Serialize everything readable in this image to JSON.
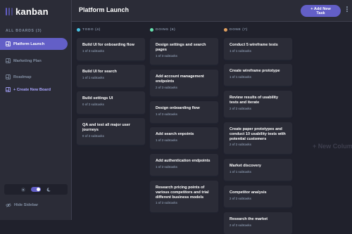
{
  "logo": {
    "text": "kanban"
  },
  "sidebar": {
    "boards_title": "ALL BOARDS (3)",
    "items": [
      {
        "label": "Platform Launch",
        "active": true
      },
      {
        "label": "Marketing Plan",
        "active": false
      },
      {
        "label": "Roadmap",
        "active": false
      }
    ],
    "create_label": "+ Create New Board",
    "hide_label": "Hide Sidebar"
  },
  "header": {
    "board_title": "Platform Launch",
    "add_task_line1": "+ Add New",
    "add_task_line2": "Task"
  },
  "columns": [
    {
      "title": "TODO (4)",
      "color": "#49c4e5",
      "tasks": [
        {
          "title": "Build UI for onboarding flow",
          "subtasks": "1 of 3 subtasks"
        },
        {
          "title": "Build UI for search",
          "subtasks": "1 of 1 subtasks"
        },
        {
          "title": "Build settings UI",
          "subtasks": "0 of 2 subtasks"
        },
        {
          "title": "QA and test all major user journeys",
          "subtasks": "0 of 2 subtasks"
        }
      ]
    },
    {
      "title": "DOING (6)",
      "color": "#67e2ae",
      "tasks": [
        {
          "title": "Design settings and search pages",
          "subtasks": "1 of 3 subtasks"
        },
        {
          "title": "Add account management endpoints",
          "subtasks": "2 of 3 subtasks"
        },
        {
          "title": "Design onboarding flow",
          "subtasks": "1 of 3 subtasks"
        },
        {
          "title": "Add search enpoints",
          "subtasks": "1 of 2 subtasks"
        },
        {
          "title": "Add authentication endpoints",
          "subtasks": "1 of 2 subtasks"
        },
        {
          "title": "Research pricing points of various competitors and trial different business models",
          "subtasks": "1 of 3 subtasks"
        }
      ]
    },
    {
      "title": "DONE (7)",
      "color": "#e09f5f",
      "tasks": [
        {
          "title": "Conduct 5 wireframe tests",
          "subtasks": "1 of 1 subtasks"
        },
        {
          "title": "Create wireframe prototype",
          "subtasks": "1 of 1 subtasks"
        },
        {
          "title": "Review results of usability tests and iterate",
          "subtasks": "2 of 2 subtasks"
        },
        {
          "title": "Create paper prototypes and conduct 10 usability tests with potential customers",
          "subtasks": "2 of 2 subtasks"
        },
        {
          "title": "Market discovery",
          "subtasks": "1 of 1 subtasks"
        },
        {
          "title": "Competitor analysis",
          "subtasks": "2 of 2 subtasks"
        },
        {
          "title": "Research the market",
          "subtasks": "2 of 2 subtasks"
        }
      ]
    }
  ],
  "new_column_label": "+ New Column",
  "icons": {
    "board": "board-icon",
    "sun": "sun-icon",
    "moon": "moon-icon",
    "hide": "eye-slash-icon",
    "menu": "vertical-ellipsis-icon"
  }
}
